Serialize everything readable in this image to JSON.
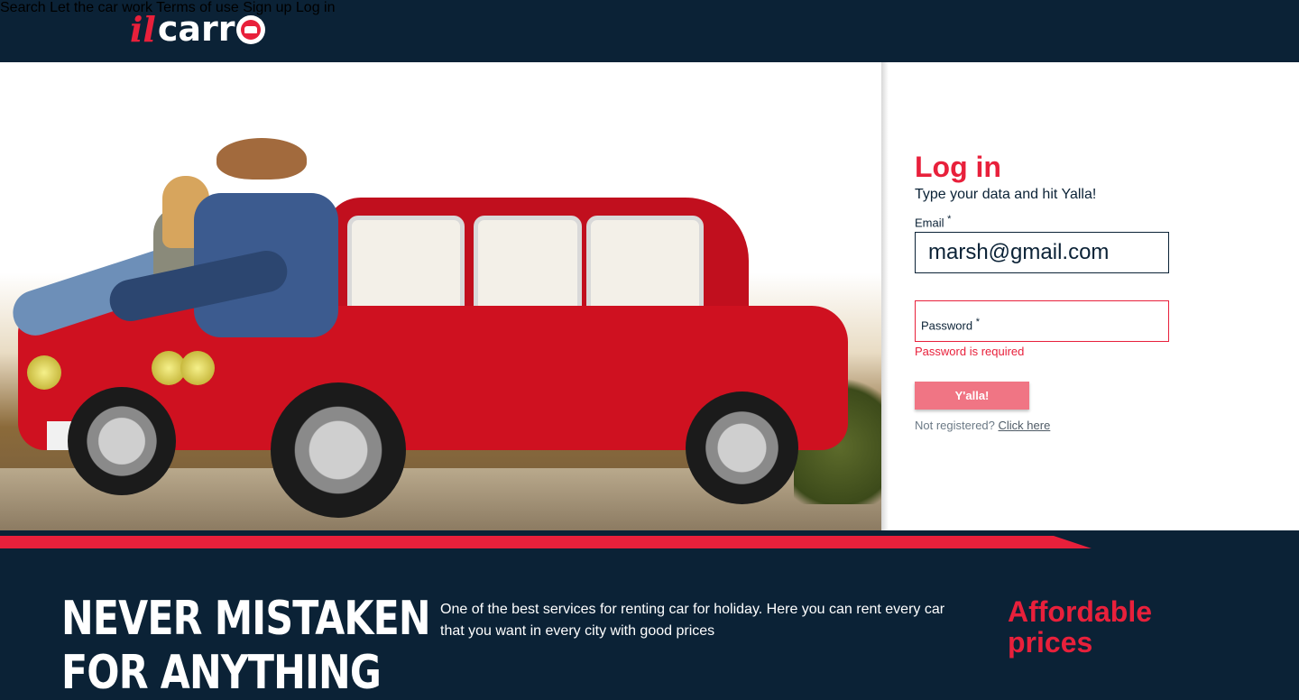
{
  "header": {
    "logo_prefix": "il",
    "logo_main": "carr",
    "nav": [
      "Search",
      "Let the car work",
      "Terms of use",
      "Sign up",
      "Log in"
    ]
  },
  "login": {
    "title": "Log in",
    "subtitle": "Type your data and hit Yalla!",
    "email_label": "Email",
    "email_value": "marsh@gmail.com",
    "required_mark": "*",
    "password_label": "Password",
    "password_error": "Password is required",
    "submit_label": "Y'alla!",
    "not_registered_text": "Not registered?",
    "register_link": "Click here"
  },
  "bottom": {
    "headline_line1": "NEVER MISTAKEN",
    "headline_line2": "FOR ANYTHING",
    "description": "One of the best services for renting car for holiday. Here you can rent every car that you want in every city with good prices",
    "feature_title": "Affordable prices"
  },
  "colors": {
    "navy": "#0b2236",
    "accent_red": "#e8203b",
    "button_pink": "#f07584"
  }
}
